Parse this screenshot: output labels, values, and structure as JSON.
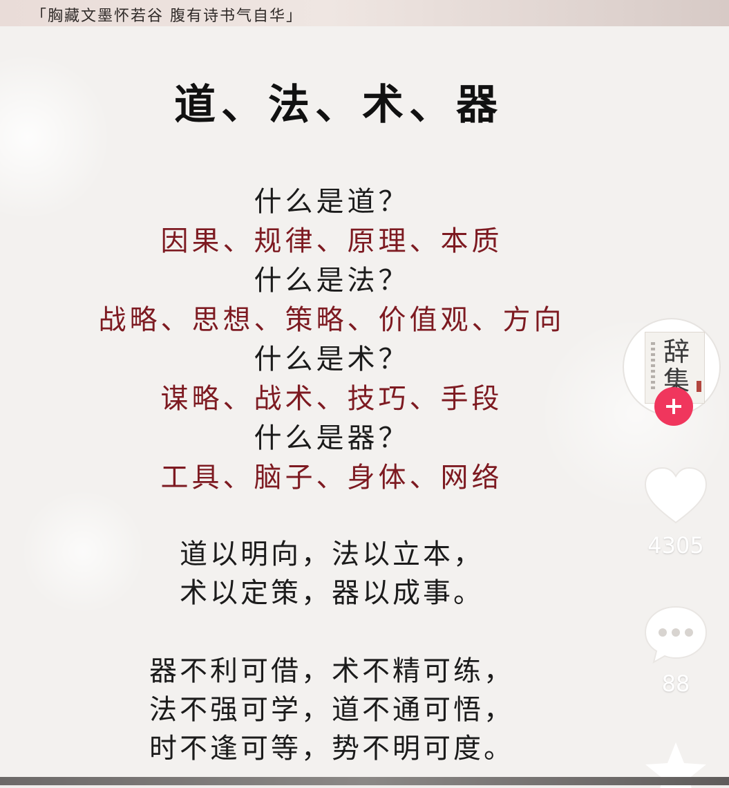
{
  "header": {
    "banner": "「胸藏文墨怀若谷  腹有诗书气自华」"
  },
  "article": {
    "title": "道、法、术、器",
    "qa": [
      {
        "question": "什么是道？",
        "answer": "因果、规律、原理、本质"
      },
      {
        "question": "什么是法？",
        "answer": "战略、思想、策略、价值观、方向"
      },
      {
        "question": "什么是术？",
        "answer": "谋略、战术、技巧、手段"
      },
      {
        "question": "什么是器？",
        "answer": "工具、脑子、身体、网络"
      }
    ],
    "poem_one": [
      "道以明向，法以立本，",
      "术以定策，器以成事。"
    ],
    "poem_two": [
      "器不利可借，术不精可练，",
      "法不强可学，道不通可悟，",
      "时不逢可等，势不明可度。"
    ]
  },
  "sidebar": {
    "avatar": {
      "glyph_1": "辞",
      "glyph_2": "集"
    },
    "like": {
      "icon": "heart-icon",
      "count": "4305"
    },
    "comment": {
      "icon": "comment-icon",
      "count": "88"
    },
    "favorite": {
      "icon": "star-icon"
    },
    "follow": {
      "icon": "plus-icon"
    }
  },
  "colors": {
    "answer": "#7d1a21",
    "follow": "#f0365d",
    "text": "#1b1b1b"
  }
}
